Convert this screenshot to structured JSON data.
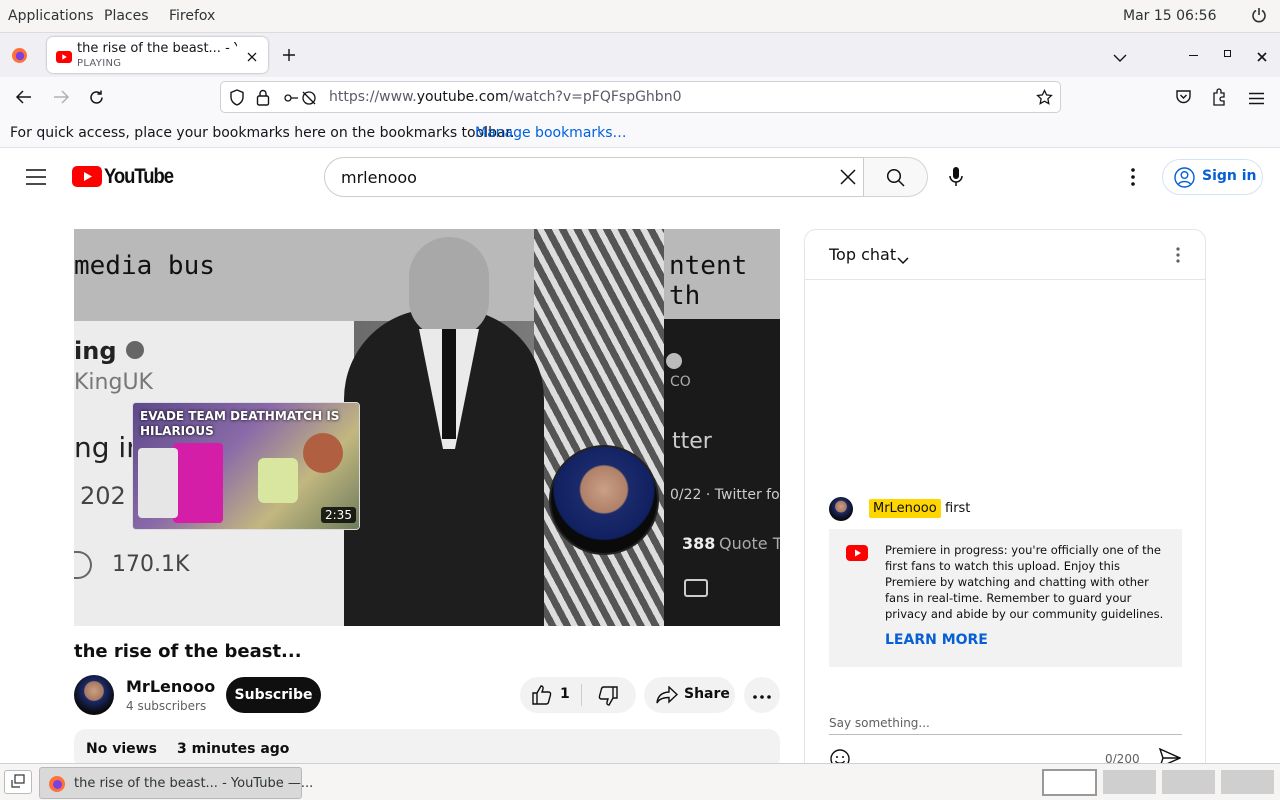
{
  "system": {
    "menus": [
      "Applications",
      "Places",
      "Firefox"
    ],
    "datetime": "Mar 15  06:56"
  },
  "browser": {
    "tab_title": "the rise of the beast... - YouTube",
    "tab_status": "PLAYING",
    "url_prefix": "https://www.",
    "url_domain": "youtube.com",
    "url_path": "/watch?v=pFQFspGhbn0",
    "bookmarks_message": "For quick access, place your bookmarks here on the bookmarks toolbar.",
    "bookmarks_link": "Manage bookmarks…"
  },
  "youtube": {
    "logo_text": "YouTube",
    "search_value": "mrlenooo",
    "sign_in": "Sign in",
    "video": {
      "title": "the rise of the beast...",
      "channel": "MrLenooo",
      "subscribers": "4 subscribers",
      "subscribe": "Subscribe",
      "likes": "1",
      "share": "Share",
      "views": "No views",
      "time_ago": "3 minutes ago",
      "overlay_lines": [
        "media bus",
        "ntent th",
        "ing",
        "KingUK",
        "ng in",
        "202",
        "170.1K",
        "CO",
        "tter",
        "0/22 · Twitter fo",
        "388",
        "Quote T"
      ]
    },
    "endscreen": {
      "title": "EVADE TEAM DEATHMATCH IS HILARIOUS",
      "duration": "2:35"
    },
    "chat": {
      "header": "Top chat",
      "message": {
        "author": "MrLenooo",
        "text": "first"
      },
      "notice": "Premiere in progress: you're officially one of the first fans to watch this upload. Enjoy this Premiere by watching and chatting with other fans in real-time. Remember to guard your privacy and abide by our community guidelines.",
      "learn_more": "LEARN MORE",
      "input_placeholder": "Say something...",
      "char_count": "0/200"
    }
  },
  "taskbar": {
    "window_title": "the rise of the beast... - YouTube —..."
  },
  "colors": {
    "youtube_red": "#ff0000",
    "link_blue": "#065fd4",
    "author_badge": "#ffd600"
  }
}
